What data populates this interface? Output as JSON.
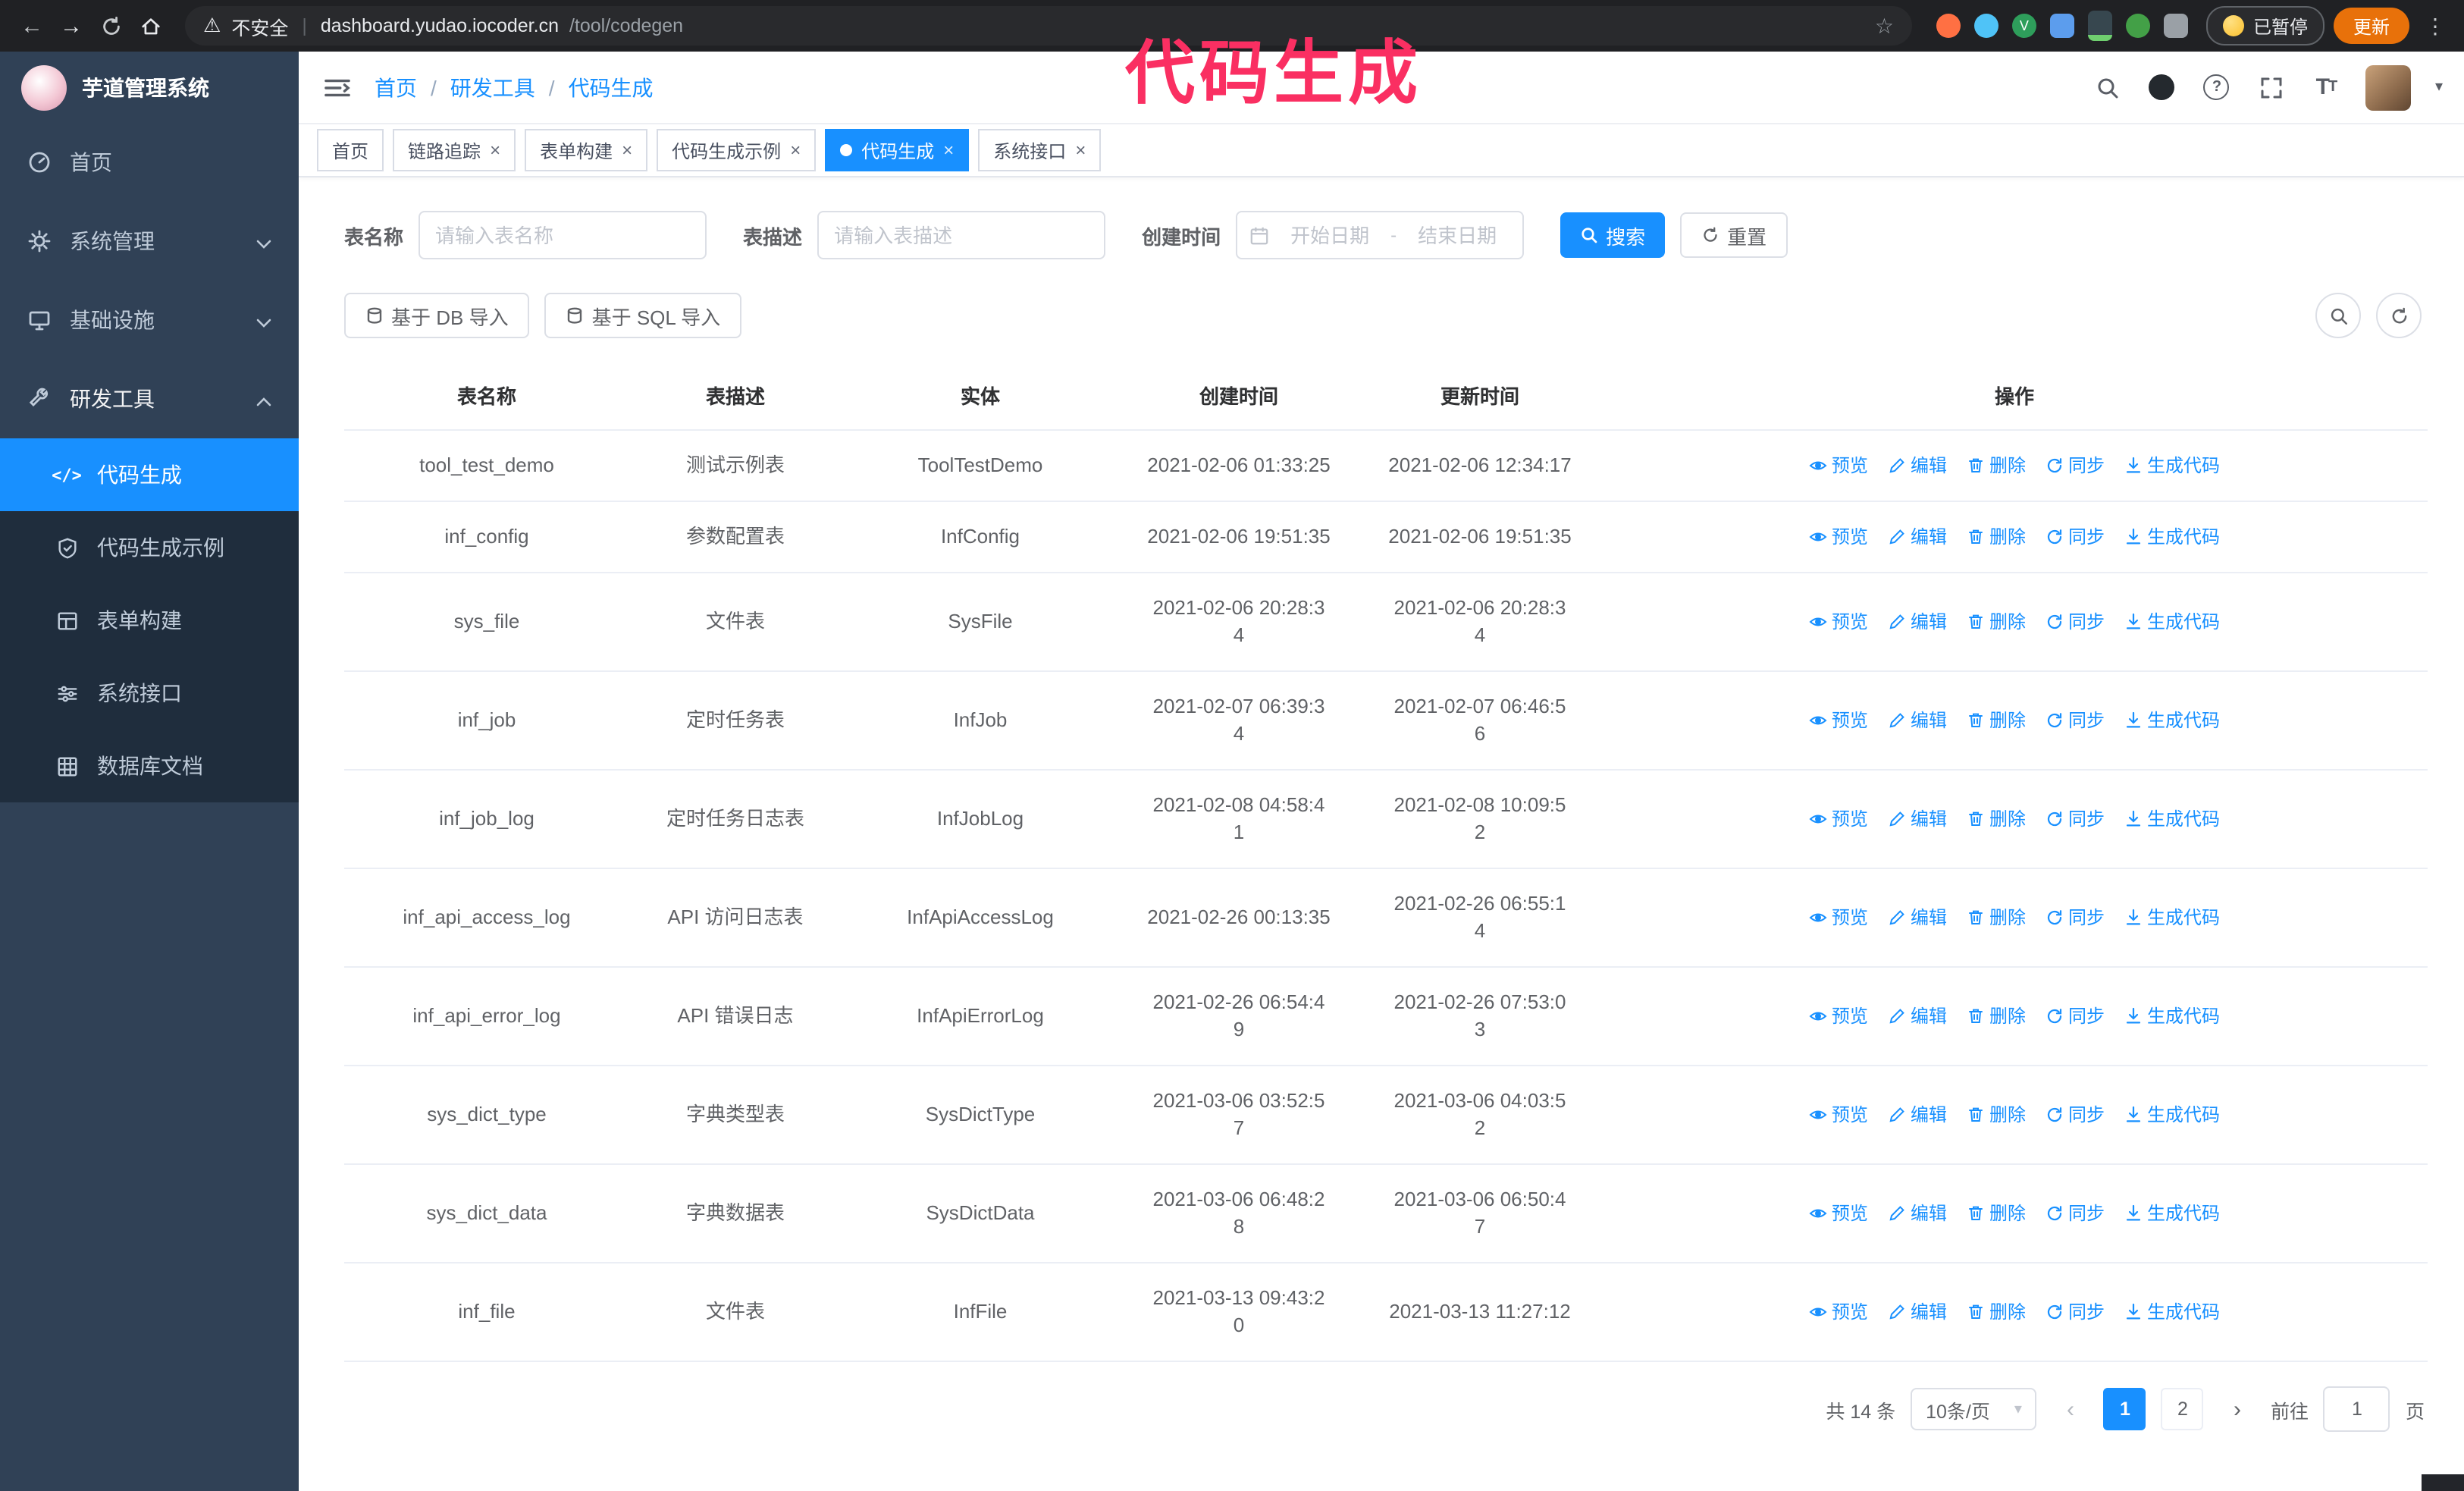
{
  "colors": {
    "accent": "#1890ff",
    "sidebar_bg": "#304156",
    "submenu_bg": "#1f2d3d",
    "annotation_pink": "#fa2f62",
    "chrome_bg": "#202124"
  },
  "icons": {
    "back": "←",
    "forward": "→",
    "warning": "⚠",
    "star": "☆",
    "kebab": "⋮",
    "code_tag": "</>",
    "close": "×",
    "prev": "‹",
    "next": "›",
    "caret_down": "▾",
    "breadcrumb_sep": "/",
    "question": "?",
    "tsize_big": "T",
    "tsize_small": "T"
  },
  "browser": {
    "security_label": "不安全",
    "url_host": "dashboard.yudao.iocoder.cn",
    "url_path": "/tool/codegen",
    "paused_badge": "已暂停",
    "update_button": "更新"
  },
  "annotation": {
    "text": "代码生成"
  },
  "sidebar": {
    "logo_title": "芋道管理系统",
    "items": [
      {
        "label": "首页"
      },
      {
        "label": "系统管理"
      },
      {
        "label": "基础设施"
      },
      {
        "label": "研发工具"
      }
    ],
    "sub_items": [
      {
        "label": "代码生成"
      },
      {
        "label": "代码生成示例"
      },
      {
        "label": "表单构建"
      },
      {
        "label": "系统接口"
      },
      {
        "label": "数据库文档"
      }
    ]
  },
  "header": {
    "breadcrumb": [
      {
        "label": "首页"
      },
      {
        "label": "研发工具"
      },
      {
        "label": "代码生成"
      }
    ]
  },
  "tabs": [
    {
      "label": "首页"
    },
    {
      "label": "链路追踪"
    },
    {
      "label": "表单构建"
    },
    {
      "label": "代码生成示例"
    },
    {
      "label": "代码生成"
    },
    {
      "label": "系统接口"
    }
  ],
  "filters": {
    "table_name_label": "表名称",
    "table_name_placeholder": "请输入表名称",
    "table_desc_label": "表描述",
    "table_desc_placeholder": "请输入表描述",
    "create_time_label": "创建时间",
    "date_start_placeholder": "开始日期",
    "date_separator": "-",
    "date_end_placeholder": "结束日期",
    "search_button": "搜索",
    "reset_button": "重置"
  },
  "toolbar": {
    "import_db": "基于 DB 导入",
    "import_sql": "基于 SQL 导入"
  },
  "table": {
    "columns": [
      "表名称",
      "表描述",
      "实体",
      "创建时间",
      "更新时间",
      "操作"
    ],
    "actions": [
      {
        "label": "预览"
      },
      {
        "label": "编辑"
      },
      {
        "label": "删除"
      },
      {
        "label": "同步"
      },
      {
        "label": "生成代码"
      }
    ],
    "rows": [
      {
        "name": "tool_test_demo",
        "desc": "测试示例表",
        "entity": "ToolTestDemo",
        "created": "2021-02-06 01:33:25",
        "updated": "2021-02-06 12:34:17"
      },
      {
        "name": "inf_config",
        "desc": "参数配置表",
        "entity": "InfConfig",
        "created": "2021-02-06 19:51:35",
        "updated": "2021-02-06 19:51:35"
      },
      {
        "name": "sys_file",
        "desc": "文件表",
        "entity": "SysFile",
        "created": "2021-02-06 20:28:3\n4",
        "updated": "2021-02-06 20:28:3\n4"
      },
      {
        "name": "inf_job",
        "desc": "定时任务表",
        "entity": "InfJob",
        "created": "2021-02-07 06:39:3\n4",
        "updated": "2021-02-07 06:46:5\n6"
      },
      {
        "name": "inf_job_log",
        "desc": "定时任务日志表",
        "entity": "InfJobLog",
        "created": "2021-02-08 04:58:4\n1",
        "updated": "2021-02-08 10:09:5\n2"
      },
      {
        "name": "inf_api_access_log",
        "desc": "API 访问日志表",
        "entity": "InfApiAccessLog",
        "created": "2021-02-26 00:13:35",
        "updated": "2021-02-26 06:55:1\n4"
      },
      {
        "name": "inf_api_error_log",
        "desc": "API 错误日志",
        "entity": "InfApiErrorLog",
        "created": "2021-02-26 06:54:4\n9",
        "updated": "2021-02-26 07:53:0\n3"
      },
      {
        "name": "sys_dict_type",
        "desc": "字典类型表",
        "entity": "SysDictType",
        "created": "2021-03-06 03:52:5\n7",
        "updated": "2021-03-06 04:03:5\n2"
      },
      {
        "name": "sys_dict_data",
        "desc": "字典数据表",
        "entity": "SysDictData",
        "created": "2021-03-06 06:48:2\n8",
        "updated": "2021-03-06 06:50:4\n7"
      },
      {
        "name": "inf_file",
        "desc": "文件表",
        "entity": "InfFile",
        "created": "2021-03-13 09:43:2\n0",
        "updated": "2021-03-13 11:27:12"
      }
    ]
  },
  "pagination": {
    "total": "共 14 条",
    "page_size": "10条/页",
    "pages": [
      "1",
      "2"
    ],
    "goto_label": "前往",
    "goto_value": "1",
    "goto_suffix": "页"
  }
}
